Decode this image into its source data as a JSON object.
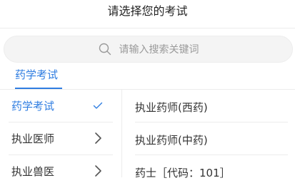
{
  "header": {
    "title": "请选择您的考试"
  },
  "search": {
    "placeholder": "请输入搜索关键词",
    "icon": "search-icon"
  },
  "tabs": [
    {
      "label": "药学考试",
      "active": true
    }
  ],
  "categories": [
    {
      "label": "药学考试",
      "selected": true,
      "icon": "check-icon"
    },
    {
      "label": "执业医师",
      "selected": false,
      "icon": "chevron-right-icon"
    },
    {
      "label": "执业兽医",
      "selected": false,
      "icon": "chevron-right-icon"
    }
  ],
  "exams": [
    {
      "label": "执业药师(西药)"
    },
    {
      "label": "执业药师(中药)"
    },
    {
      "label": "药士［代码：101］"
    }
  ],
  "colors": {
    "accent": "#2f7de1",
    "text": "#333333",
    "placeholder": "#9a9a9a",
    "divider": "#ececec"
  }
}
